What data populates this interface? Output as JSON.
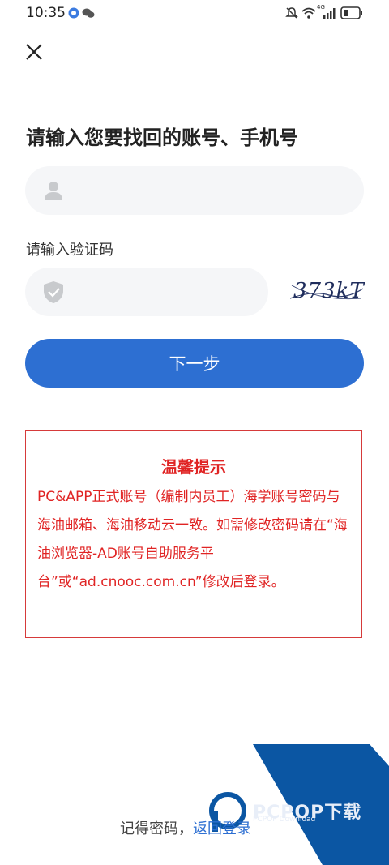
{
  "status_bar": {
    "time": "10:35",
    "network_label": "4G"
  },
  "form": {
    "title": "请输入您要找回的账号、手机号",
    "account_placeholder": "",
    "captcha_label": "请输入验证码",
    "captcha_placeholder": "",
    "captcha_text": "373kT",
    "next_button": "下一步"
  },
  "notice": {
    "title": "温馨提示",
    "body": "PC&APP正式账号（编制内员工）海学账号密码与海油邮箱、海油移动云一致。如需修改密码请在“海油浏览器-AD账号自助服务平台”或“ad.cnooc.com.cn”修改后登录。"
  },
  "footer": {
    "prefix": "记得密码，",
    "link": "返回登录"
  },
  "watermark": {
    "brand": "PCPOP下载",
    "sub": "PCPOP Download"
  },
  "colors": {
    "primary": "#2d6fd2",
    "notice_red": "#e02424",
    "field_bg": "#f5f6f8"
  }
}
